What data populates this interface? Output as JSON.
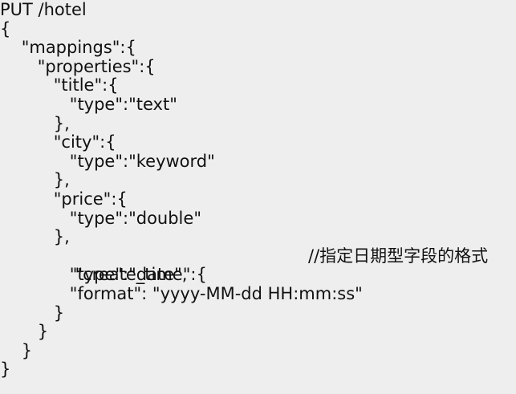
{
  "code_view": {
    "lines": [
      {
        "text": "PUT /hotel"
      },
      {
        "text": "{"
      },
      {
        "text": "    \"mappings\":{"
      },
      {
        "text": "       \"properties\":{"
      },
      {
        "text": "          \"title\":{"
      },
      {
        "text": "             \"type\":\"text\""
      },
      {
        "text": "          },"
      },
      {
        "text": "          \"city\":{"
      },
      {
        "text": "             \"type\":\"keyword\""
      },
      {
        "text": "          },"
      },
      {
        "text": "          \"price\":{"
      },
      {
        "text": "             \"type\":\"double\""
      },
      {
        "text": "          },"
      },
      {
        "text": "          \"create_time\":{",
        "comment": "//指定日期型字段的格式"
      },
      {
        "text": "             \"type\":\"date\","
      },
      {
        "text": "             \"format\": \"yyyy-MM-dd HH:mm:ss\""
      },
      {
        "text": "          }"
      },
      {
        "text": "       }"
      },
      {
        "text": "    }"
      },
      {
        "text": "}"
      }
    ]
  }
}
